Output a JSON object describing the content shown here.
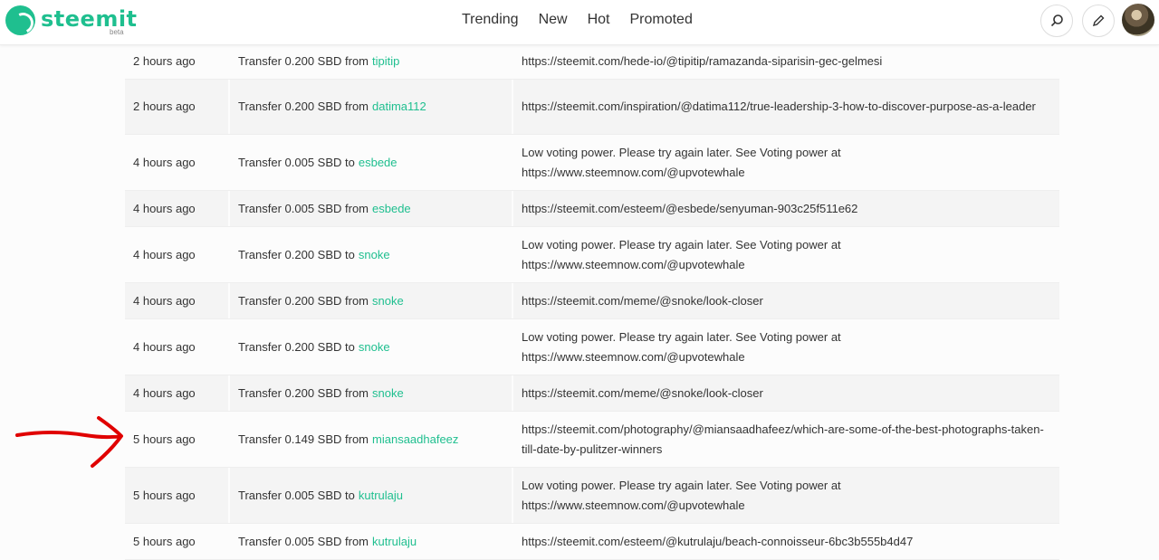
{
  "header": {
    "logo_text": "steemit",
    "logo_beta": "beta",
    "nav": [
      "Trending",
      "New",
      "Hot",
      "Promoted"
    ]
  },
  "rows": [
    {
      "time": "2 hours ago",
      "action": "Transfer 0.200 SBD from",
      "user": "tipitip",
      "memo": "https://steemit.com/hede-io/@tipitip/ramazanda-siparisin-gec-gelmesi"
    },
    {
      "time": "2 hours ago",
      "action": "Transfer 0.200 SBD from",
      "user": "datima112",
      "memo": "https://steemit.com/inspiration/@datima112/true-leadership-3-how-to-discover-purpose-as-a-leader"
    },
    {
      "time": "4 hours ago",
      "action": "Transfer 0.005 SBD to",
      "user": "esbede",
      "memo": "Low voting power. Please try again later. See Voting power at https://www.steemnow.com/@upvotewhale"
    },
    {
      "time": "4 hours ago",
      "action": "Transfer 0.005 SBD from",
      "user": "esbede",
      "memo": "https://steemit.com/esteem/@esbede/senyuman-903c25f511e62"
    },
    {
      "time": "4 hours ago",
      "action": "Transfer 0.200 SBD to",
      "user": "snoke",
      "memo": "Low voting power. Please try again later. See Voting power at https://www.steemnow.com/@upvotewhale"
    },
    {
      "time": "4 hours ago",
      "action": "Transfer 0.200 SBD from",
      "user": "snoke",
      "memo": "https://steemit.com/meme/@snoke/look-closer"
    },
    {
      "time": "4 hours ago",
      "action": "Transfer 0.200 SBD to",
      "user": "snoke",
      "memo": "Low voting power. Please try again later. See Voting power at https://www.steemnow.com/@upvotewhale"
    },
    {
      "time": "4 hours ago",
      "action": "Transfer 0.200 SBD from",
      "user": "snoke",
      "memo": "https://steemit.com/meme/@snoke/look-closer"
    },
    {
      "time": "5 hours ago",
      "action": "Transfer 0.149 SBD from",
      "user": "miansaadhafeez",
      "memo": "https://steemit.com/photography/@miansaadhafeez/which-are-some-of-the-best-photographs-taken-till-date-by-pulitzer-winners"
    },
    {
      "time": "5 hours ago",
      "action": "Transfer 0.005 SBD to",
      "user": "kutrulaju",
      "memo": "Low voting power. Please try again later. See Voting power at https://www.steemnow.com/@upvotewhale"
    },
    {
      "time": "5 hours ago",
      "action": "Transfer 0.005 SBD from",
      "user": "kutrulaju",
      "memo": "https://steemit.com/esteem/@kutrulaju/beach-connoisseur-6bc3b555b4d47"
    }
  ],
  "icons": {
    "search": "search-icon",
    "edit": "pencil-icon"
  },
  "colors": {
    "accent": "#1fbf8f",
    "annotation": "#e00000"
  }
}
